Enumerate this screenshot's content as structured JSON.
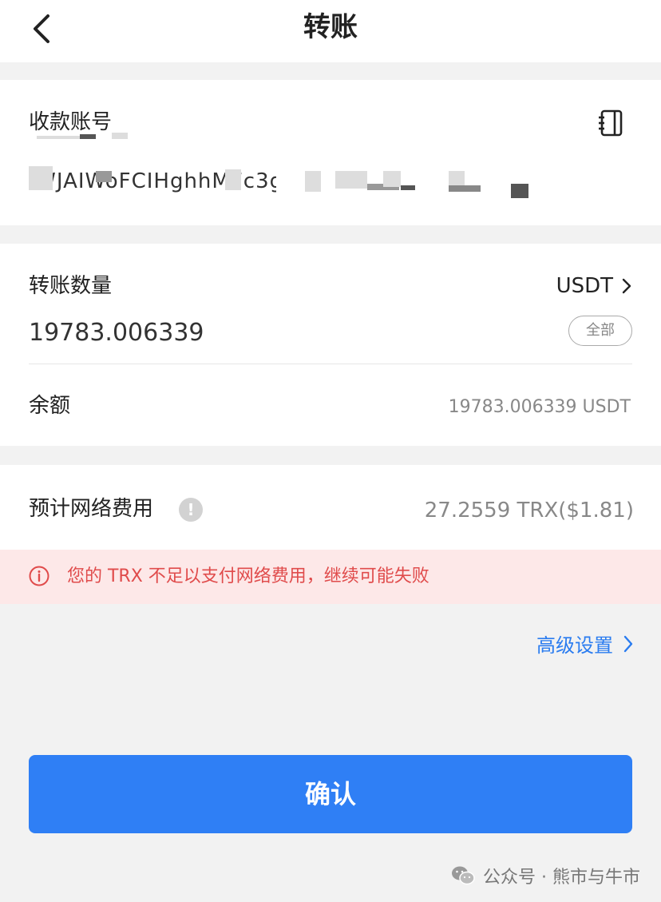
{
  "nav": {
    "title": "转账"
  },
  "recipient": {
    "label": "收款账号",
    "address_partial": "'WJAIWoFCIHghhMFc3g"
  },
  "amount": {
    "label": "转账数量",
    "token": "USDT",
    "value": "19783.006339",
    "all_button": "全部"
  },
  "balance": {
    "label": "余额",
    "value": "19783.006339 USDT"
  },
  "fee": {
    "label": "预计网络费用",
    "value": "27.2559 TRX($1.81)"
  },
  "warning": {
    "text": "您的 TRX 不足以支付网络费用，继续可能失败",
    "color": "#e04b4b"
  },
  "advanced": {
    "label": "高级设置"
  },
  "confirm": {
    "label": "确认",
    "color": "#2f7ff5"
  },
  "watermark": {
    "text": "公众号 · 熊市与牛市"
  },
  "icons": {
    "back": "chevron-left-icon",
    "address_book": "address-book-icon",
    "token_chevron": "chevron-right-icon",
    "info": "exclamation-icon",
    "warning": "info-circle-icon",
    "advanced_chevron": "chevron-right-icon",
    "wechat": "wechat-icon"
  }
}
